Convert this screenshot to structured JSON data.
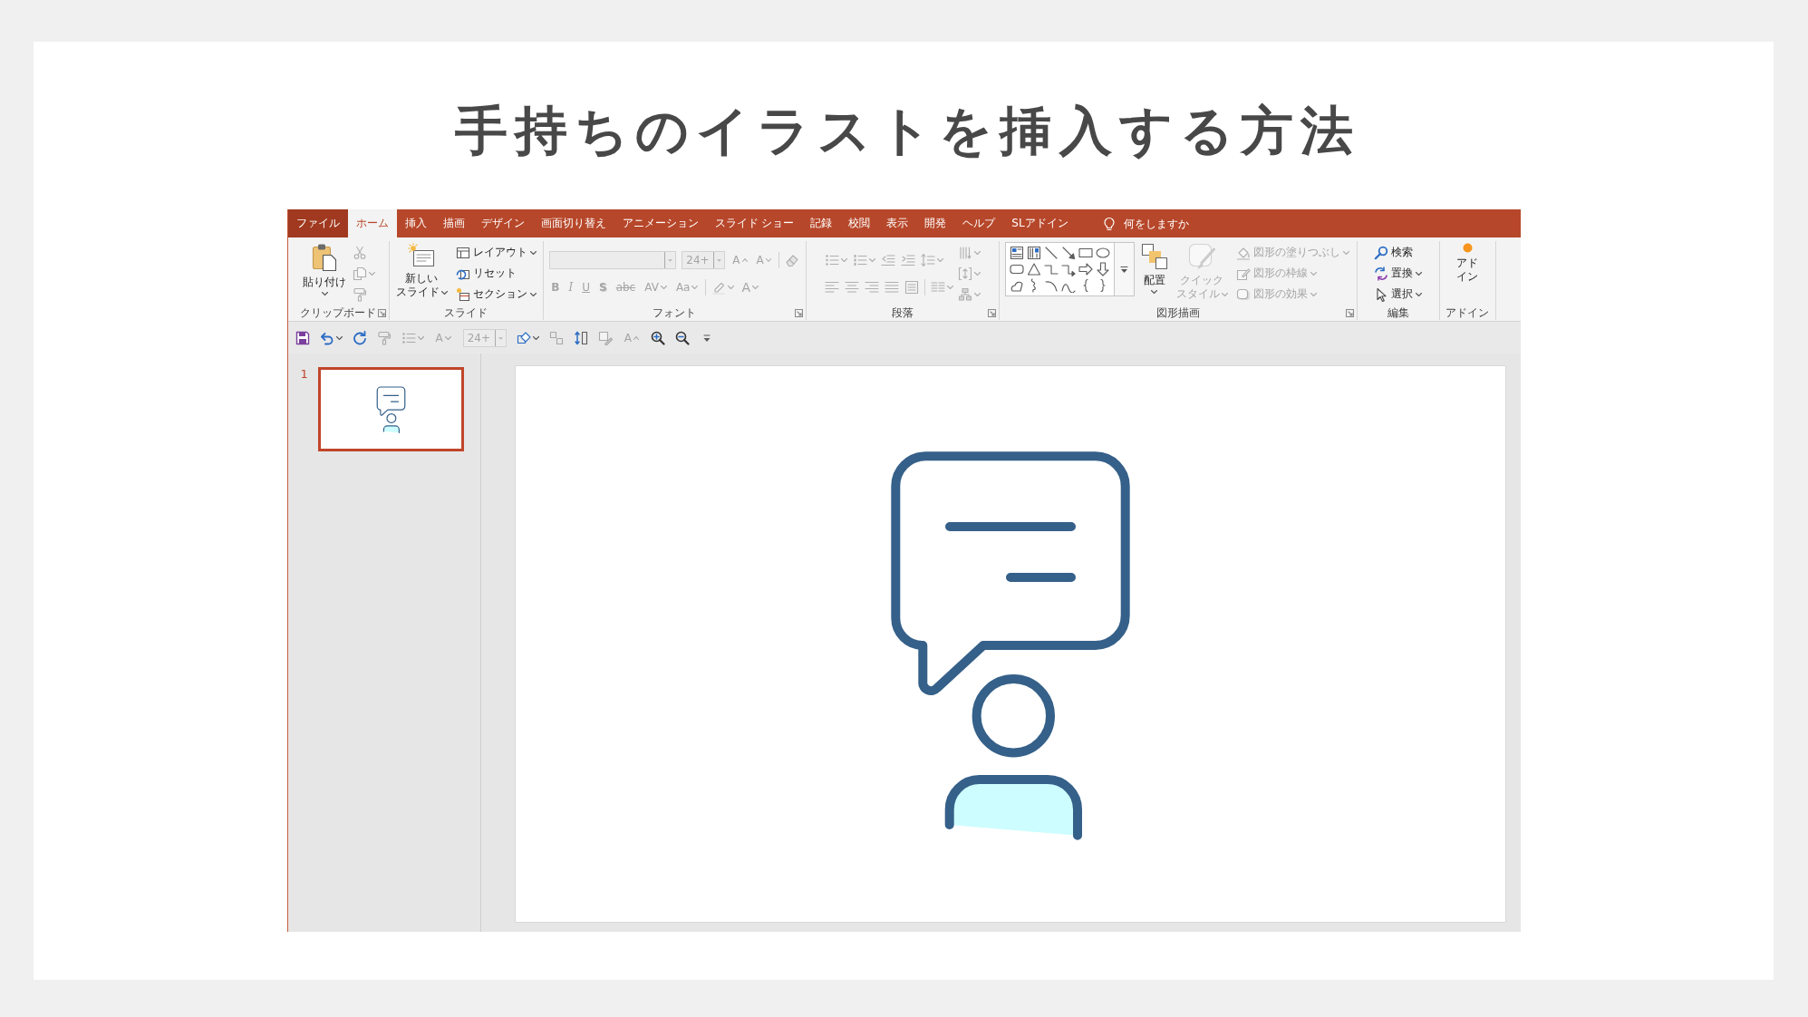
{
  "title": "手持ちのイラストを挿入する方法",
  "window": {
    "tabs": [
      {
        "label": "ファイル",
        "kind": "file",
        "selected": false
      },
      {
        "label": "ホーム",
        "kind": "tab",
        "selected": true
      },
      {
        "label": "挿入",
        "kind": "tab",
        "selected": false
      },
      {
        "label": "描画",
        "kind": "tab",
        "selected": false
      },
      {
        "label": "デザイン",
        "kind": "tab",
        "selected": false
      },
      {
        "label": "画面切り替え",
        "kind": "tab",
        "selected": false
      },
      {
        "label": "アニメーション",
        "kind": "tab",
        "selected": false
      },
      {
        "label": "スライド ショー",
        "kind": "tab",
        "selected": false
      },
      {
        "label": "記録",
        "kind": "tab",
        "selected": false
      },
      {
        "label": "校閲",
        "kind": "tab",
        "selected": false
      },
      {
        "label": "表示",
        "kind": "tab",
        "selected": false
      },
      {
        "label": "開発",
        "kind": "tab",
        "selected": false
      },
      {
        "label": "ヘルプ",
        "kind": "tab",
        "selected": false
      },
      {
        "label": "SLアドイン",
        "kind": "tab",
        "selected": false
      }
    ],
    "tell_me": {
      "placeholder": "何をしますか"
    },
    "ribbon": {
      "groups": [
        {
          "label": "クリップボード",
          "launcher": true,
          "columns": [
            {
              "kind": "large",
              "lines": [
                "貼り付け"
              ],
              "menu": true,
              "disabled": false
            },
            {
              "kind": "stack",
              "rows": [
                {
                  "items": [
                    {
                      "kind": "icon",
                      "menu": false,
                      "disabled": true
                    }
                  ]
                },
                {
                  "items": [
                    {
                      "kind": "icon",
                      "menu": true,
                      "disabled": true
                    }
                  ]
                },
                {
                  "items": [
                    {
                      "kind": "icon",
                      "menu": false,
                      "disabled": true
                    }
                  ]
                }
              ]
            }
          ]
        },
        {
          "label": "スライド",
          "launcher": false,
          "columns": [
            {
              "kind": "large",
              "lines": [
                "新しい",
                "スライド"
              ],
              "menu": true,
              "disabled": false
            },
            {
              "kind": "stack",
              "rows": [
                {
                  "items": [
                    {
                      "kind": "button",
                      "label": "レイアウト",
                      "menu": true,
                      "disabled": false
                    }
                  ]
                },
                {
                  "items": [
                    {
                      "kind": "button",
                      "label": "リセット",
                      "menu": false,
                      "disabled": false
                    }
                  ]
                },
                {
                  "items": [
                    {
                      "kind": "button",
                      "label": "セクション",
                      "menu": true,
                      "disabled": false
                    }
                  ]
                }
              ]
            }
          ]
        },
        {
          "label": "フォント",
          "launcher": true,
          "columns": [
            {
              "kind": "stack",
              "rows": [
                {
                  "items": [
                    {
                      "kind": "fontname",
                      "disabled": true
                    },
                    {
                      "kind": "fontsize",
                      "value": "24+",
                      "disabled": true
                    },
                    {
                      "kind": "glyph",
                      "label": "A",
                      "menu": false,
                      "disabled": true
                    },
                    {
                      "kind": "glyph",
                      "label": "A",
                      "menu": false,
                      "disabled": true
                    },
                    {
                      "kind": "divider"
                    },
                    {
                      "kind": "icon",
                      "menu": false,
                      "disabled": true
                    }
                  ]
                },
                {
                  "items": [
                    {
                      "kind": "glyph",
                      "label": "B",
                      "menu": false,
                      "disabled": true
                    },
                    {
                      "kind": "glyph",
                      "label": "I",
                      "menu": false,
                      "disabled": true
                    },
                    {
                      "kind": "glyph",
                      "label": "U",
                      "menu": false,
                      "disabled": true
                    },
                    {
                      "kind": "glyph",
                      "label": "S",
                      "menu": false,
                      "disabled": true
                    },
                    {
                      "kind": "glyph",
                      "label": "abc",
                      "menu": false,
                      "disabled": true
                    },
                    {
                      "kind": "glyph",
                      "label": "AV",
                      "menu": true,
                      "disabled": true
                    },
                    {
                      "kind": "glyph",
                      "label": "Aa",
                      "menu": true,
                      "disabled": true
                    },
                    {
                      "kind": "divider"
                    },
                    {
                      "kind": "icon",
                      "menu": true,
                      "disabled": true
                    },
                    {
                      "kind": "glyph",
                      "label": "A",
                      "menu": true,
                      "disabled": true
                    }
                  ]
                }
              ]
            }
          ]
        },
        {
          "label": "段落",
          "launcher": true,
          "columns": [
            {
              "kind": "stack",
              "rows": [
                {
                  "items": [
                    {
                      "kind": "icon",
                      "menu": true,
                      "disabled": true
                    },
                    {
                      "kind": "icon",
                      "menu": true,
                      "disabled": true
                    },
                    {
                      "kind": "icon",
                      "menu": false,
                      "disabled": true
                    },
                    {
                      "kind": "icon",
                      "menu": false,
                      "disabled": true
                    },
                    {
                      "kind": "icon",
                      "menu": true,
                      "disabled": true
                    }
                  ]
                },
                {
                  "items": [
                    {
                      "kind": "icon",
                      "menu": false,
                      "disabled": true
                    },
                    {
                      "kind": "icon",
                      "menu": false,
                      "disabled": true
                    },
                    {
                      "kind": "icon",
                      "menu": false,
                      "disabled": true
                    },
                    {
                      "kind": "icon",
                      "menu": false,
                      "disabled": true
                    },
                    {
                      "kind": "icon",
                      "menu": false,
                      "disabled": true
                    },
                    {
                      "kind": "divider"
                    },
                    {
                      "kind": "icon",
                      "menu": true,
                      "disabled": true
                    }
                  ]
                }
              ]
            },
            {
              "kind": "stack",
              "rows": [
                {
                  "items": [
                    {
                      "kind": "icon",
                      "menu": true,
                      "disabled": true
                    }
                  ]
                },
                {
                  "items": [
                    {
                      "kind": "icon",
                      "menu": true,
                      "disabled": true
                    }
                  ]
                },
                {
                  "items": [
                    {
                      "kind": "icon",
                      "menu": true,
                      "disabled": true
                    }
                  ]
                }
              ]
            }
          ]
        },
        {
          "label": "図形描画",
          "launcher": true,
          "columns": [
            {
              "kind": "gallery"
            },
            {
              "kind": "large",
              "lines": [
                "配置"
              ],
              "menu": true,
              "disabled": false
            },
            {
              "kind": "large",
              "lines": [
                "クイック",
                "スタイル"
              ],
              "menu": true,
              "disabled": true
            },
            {
              "kind": "stack",
              "rows": [
                {
                  "items": [
                    {
                      "kind": "button",
                      "label": "図形の塗りつぶし",
                      "menu": true,
                      "disabled": true
                    }
                  ]
                },
                {
                  "items": [
                    {
                      "kind": "button",
                      "label": "図形の枠線",
                      "menu": true,
                      "disabled": true
                    }
                  ]
                },
                {
                  "items": [
                    {
                      "kind": "button",
                      "label": "図形の効果",
                      "menu": true,
                      "disabled": true
                    }
                  ]
                }
              ]
            }
          ]
        },
        {
          "label": "編集",
          "launcher": false,
          "columns": [
            {
              "kind": "stack",
              "rows": [
                {
                  "items": [
                    {
                      "kind": "button",
                      "label": "検索",
                      "menu": false,
                      "disabled": false
                    }
                  ]
                },
                {
                  "items": [
                    {
                      "kind": "button",
                      "label": "置換",
                      "menu": true,
                      "disabled": false
                    }
                  ]
                },
                {
                  "items": [
                    {
                      "kind": "button",
                      "label": "選択",
                      "menu": true,
                      "disabled": false
                    }
                  ]
                }
              ]
            }
          ]
        },
        {
          "label": "アドイン",
          "launcher": false,
          "columns": [
            {
              "kind": "large",
              "lines": [
                "アド",
                "イン"
              ],
              "menu": false,
              "disabled": false
            }
          ]
        }
      ]
    },
    "quick_access": [
      {
        "kind": "icon",
        "menu": false,
        "disabled": false
      },
      {
        "kind": "icon",
        "menu": true,
        "disabled": false
      },
      {
        "kind": "icon",
        "menu": false,
        "disabled": false
      },
      {
        "kind": "icon",
        "menu": false,
        "disabled": true
      },
      {
        "kind": "icon",
        "menu": true,
        "disabled": true
      },
      {
        "kind": "glyph",
        "label": "A",
        "menu": true,
        "disabled": true
      },
      {
        "kind": "fontsize",
        "value": "24+",
        "disabled": true
      },
      {
        "kind": "icon",
        "menu": true,
        "disabled": false
      },
      {
        "kind": "icon",
        "menu": false,
        "disabled": true
      },
      {
        "kind": "icon",
        "menu": false,
        "disabled": false
      },
      {
        "kind": "icon",
        "menu": false,
        "disabled": true
      },
      {
        "kind": "glyph",
        "label": "A",
        "menu": false,
        "disabled": true
      },
      {
        "kind": "icon",
        "menu": false,
        "disabled": false
      },
      {
        "kind": "icon",
        "menu": false,
        "disabled": false
      },
      {
        "kind": "icon",
        "menu": false,
        "disabled": false
      }
    ],
    "slides_pane": {
      "thumbnails": [
        {
          "number": "1",
          "selected": true
        }
      ]
    }
  }
}
